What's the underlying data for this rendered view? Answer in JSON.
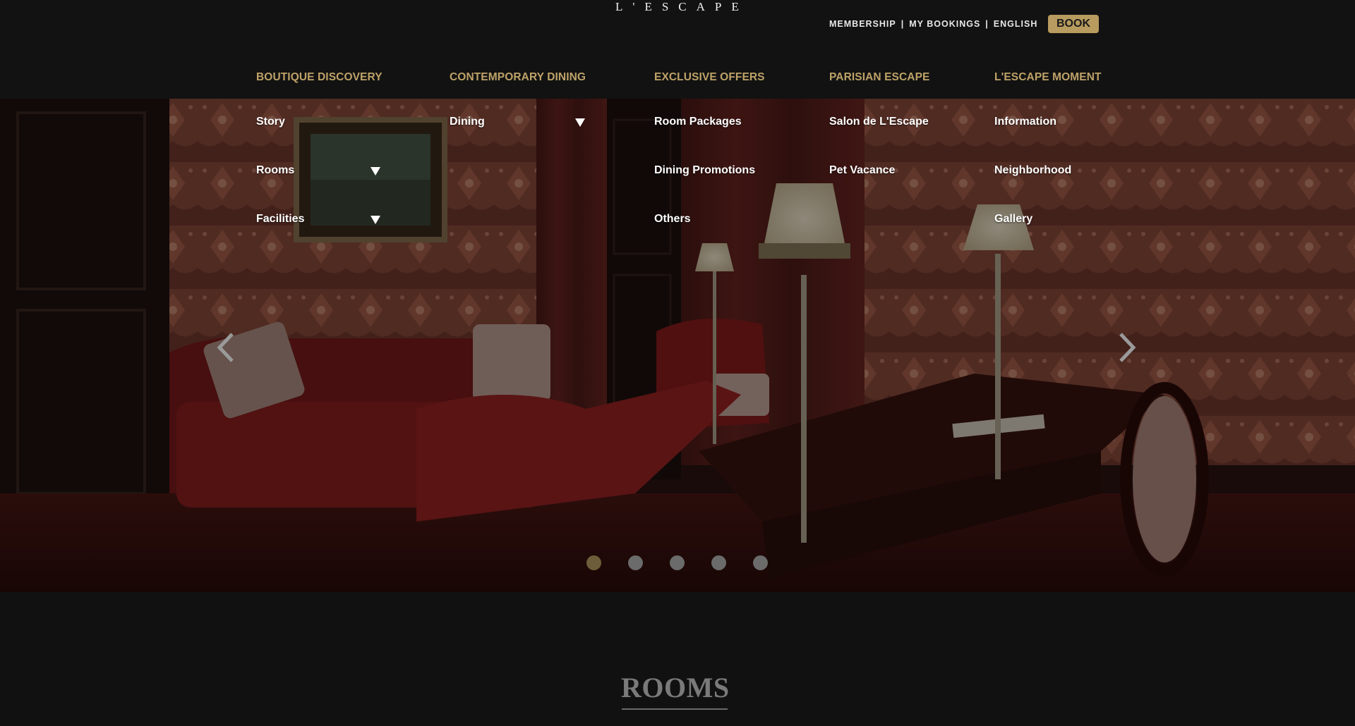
{
  "header": {
    "logo_text": "L'ESCAPE",
    "utility_links": [
      "MEMBERSHIP",
      "MY BOOKINGS",
      "ENGLISH"
    ],
    "separator": "|",
    "book_label": "BOOK"
  },
  "nav": {
    "columns": [
      {
        "heading": "BOUTIQUE DISCOVERY",
        "items": [
          "Story",
          "Rooms",
          "Facilities"
        ]
      },
      {
        "heading": "CONTEMPORARY DINING",
        "items": [
          "Dining"
        ]
      },
      {
        "heading": "EXCLUSIVE OFFERS",
        "items": [
          "Room Packages",
          "Dining Promotions",
          "Others"
        ]
      },
      {
        "heading": "PARISIAN ESCAPE",
        "items": [
          "Salon de L'Escape",
          "Pet Vacance"
        ]
      },
      {
        "heading": "L'ESCAPE MOMENT",
        "items": [
          "Information",
          "Neighborhood",
          "Gallery"
        ]
      }
    ]
  },
  "hero": {
    "prev_icon": "chevron-left-icon",
    "next_icon": "chevron-right-icon",
    "slide_count": 5,
    "active_slide": 1
  },
  "section": {
    "title": "ROOMS"
  },
  "colors": {
    "background": "#111111",
    "gold": "#bea268",
    "book_button": "#b89b5e"
  }
}
